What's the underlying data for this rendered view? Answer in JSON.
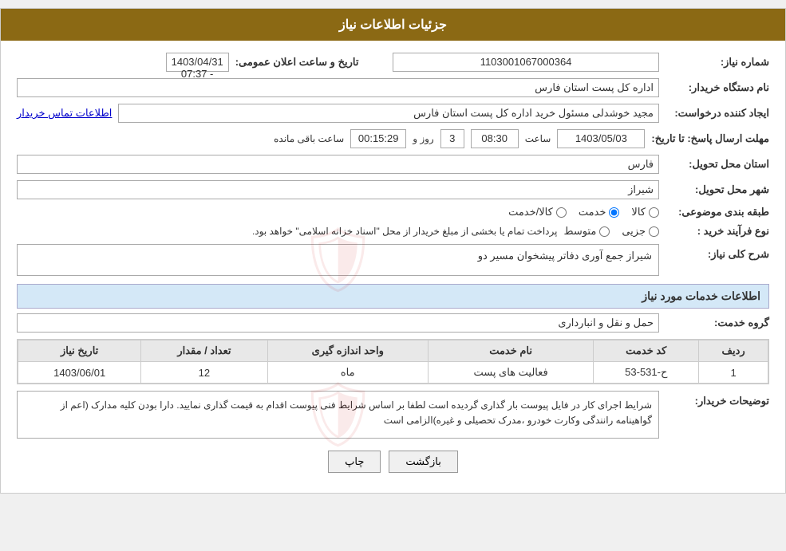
{
  "header": {
    "title": "جزئیات اطلاعات نیاز"
  },
  "fields": {
    "need_number_label": "شماره نیاز:",
    "need_number_value": "1103001067000364",
    "announcement_datetime_label": "تاریخ و ساعت اعلان عمومی:",
    "announcement_datetime_value": "1403/04/31 - 07:37",
    "buyer_org_label": "نام دستگاه خریدار:",
    "buyer_org_value": "اداره کل پست استان فارس",
    "creator_label": "ایجاد کننده درخواست:",
    "creator_value": "مجید خوشدلی مسئول خرید اداره کل پست استان فارس",
    "contact_link": "اطلاعات تماس خریدار",
    "send_deadline_label": "مهلت ارسال پاسخ: تا تاریخ:",
    "send_date_value": "1403/05/03",
    "send_time_label": "ساعت",
    "send_time_value": "08:30",
    "send_days_label": "روز و",
    "send_days_value": "3",
    "send_remaining_label": "ساعت باقی مانده",
    "send_remaining_value": "00:15:29",
    "province_label": "استان محل تحویل:",
    "province_value": "فارس",
    "city_label": "شهر محل تحویل:",
    "city_value": "شیراز",
    "category_label": "طبقه بندی موضوعی:",
    "category_options": [
      "کالا",
      "خدمت",
      "کالا/خدمت"
    ],
    "category_selected": "خدمت",
    "purchase_type_label": "نوع فرآیند خرید :",
    "purchase_type_options": [
      "جزیی",
      "متوسط"
    ],
    "purchase_type_note": "پرداخت تمام یا بخشی از مبلغ خریدار از محل \"اسناد خزانه اسلامی\" خواهد بود.",
    "need_description_label": "شرح کلی نیاز:",
    "need_description_value": "شیراز جمع آوری دفاتر پیشخوان مسیر دو",
    "services_section_label": "اطلاعات خدمات مورد نیاز",
    "service_group_label": "گروه خدمت:",
    "service_group_value": "حمل و نقل و انبارداری",
    "table": {
      "columns": [
        "ردیف",
        "کد خدمت",
        "نام خدمت",
        "واحد اندازه گیری",
        "تعداد / مقدار",
        "تاریخ نیاز"
      ],
      "rows": [
        {
          "row": "1",
          "service_code": "ح-531-53",
          "service_name": "فعالیت های پست",
          "unit": "ماه",
          "quantity": "12",
          "date": "1403/06/01"
        }
      ]
    },
    "buyer_desc_label": "توضیحات خریدار:",
    "buyer_desc_value": "شرایط اجرای کار در فایل پیوست بار گذاری گردیده است لطفا بر اساس شرایط فنی پیوست اقدام به قیمت گذاری نمایید.\nدارا بودن کلیه مدارک (اعم از گواهینامه رانندگی وکارت خودرو ،مدرک تحصیلی و غیره)الزامی است"
  },
  "buttons": {
    "back_label": "بازگشت",
    "print_label": "چاپ"
  }
}
